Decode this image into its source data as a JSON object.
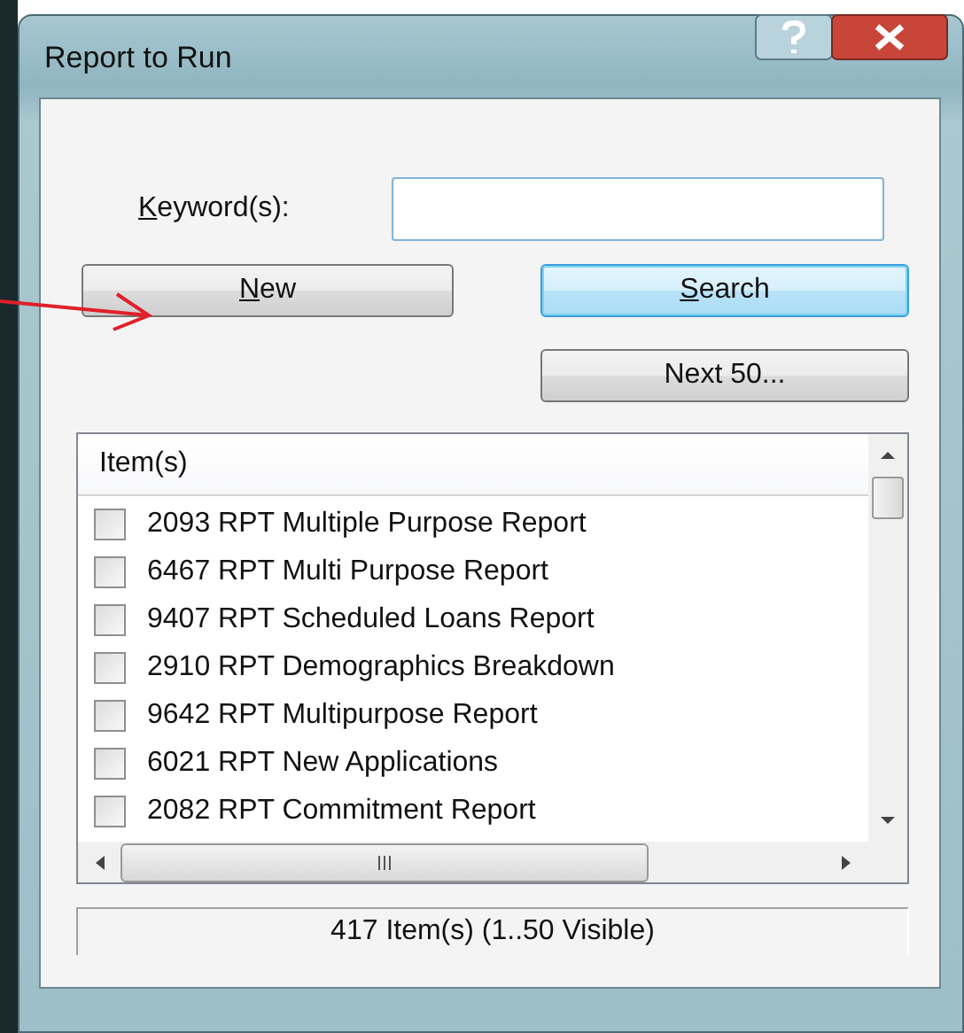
{
  "window": {
    "title": "Report to Run"
  },
  "keyword": {
    "label": {
      "mnemonic": "K",
      "rest": "eyword(s):"
    }
  },
  "buttons": [
    {
      "mnemonic": "N",
      "rest": "ew",
      "kind": "normal"
    },
    {
      "mnemonic": "S",
      "rest": "earch",
      "kind": "default"
    },
    {
      "rest": "Next 50...",
      "kind": "normal"
    }
  ],
  "list": {
    "header": "Item(s)",
    "items": [
      {
        "label": "2093 RPT Multiple Purpose Report",
        "checked": false
      },
      {
        "label": "6467 RPT Multi Purpose Report",
        "checked": false
      },
      {
        "label": "9407 RPT Scheduled Loans Report",
        "checked": false
      },
      {
        "label": "2910 RPT Demographics Breakdown",
        "checked": false
      },
      {
        "label": "9642 RPT Multipurpose Report",
        "checked": false
      },
      {
        "label": "6021 RPT New Applications",
        "checked": false
      },
      {
        "label": "2082 RPT Commitment Report",
        "checked": false
      }
    ]
  },
  "status_bar": "417 Item(s) (1..50 Visible)"
}
